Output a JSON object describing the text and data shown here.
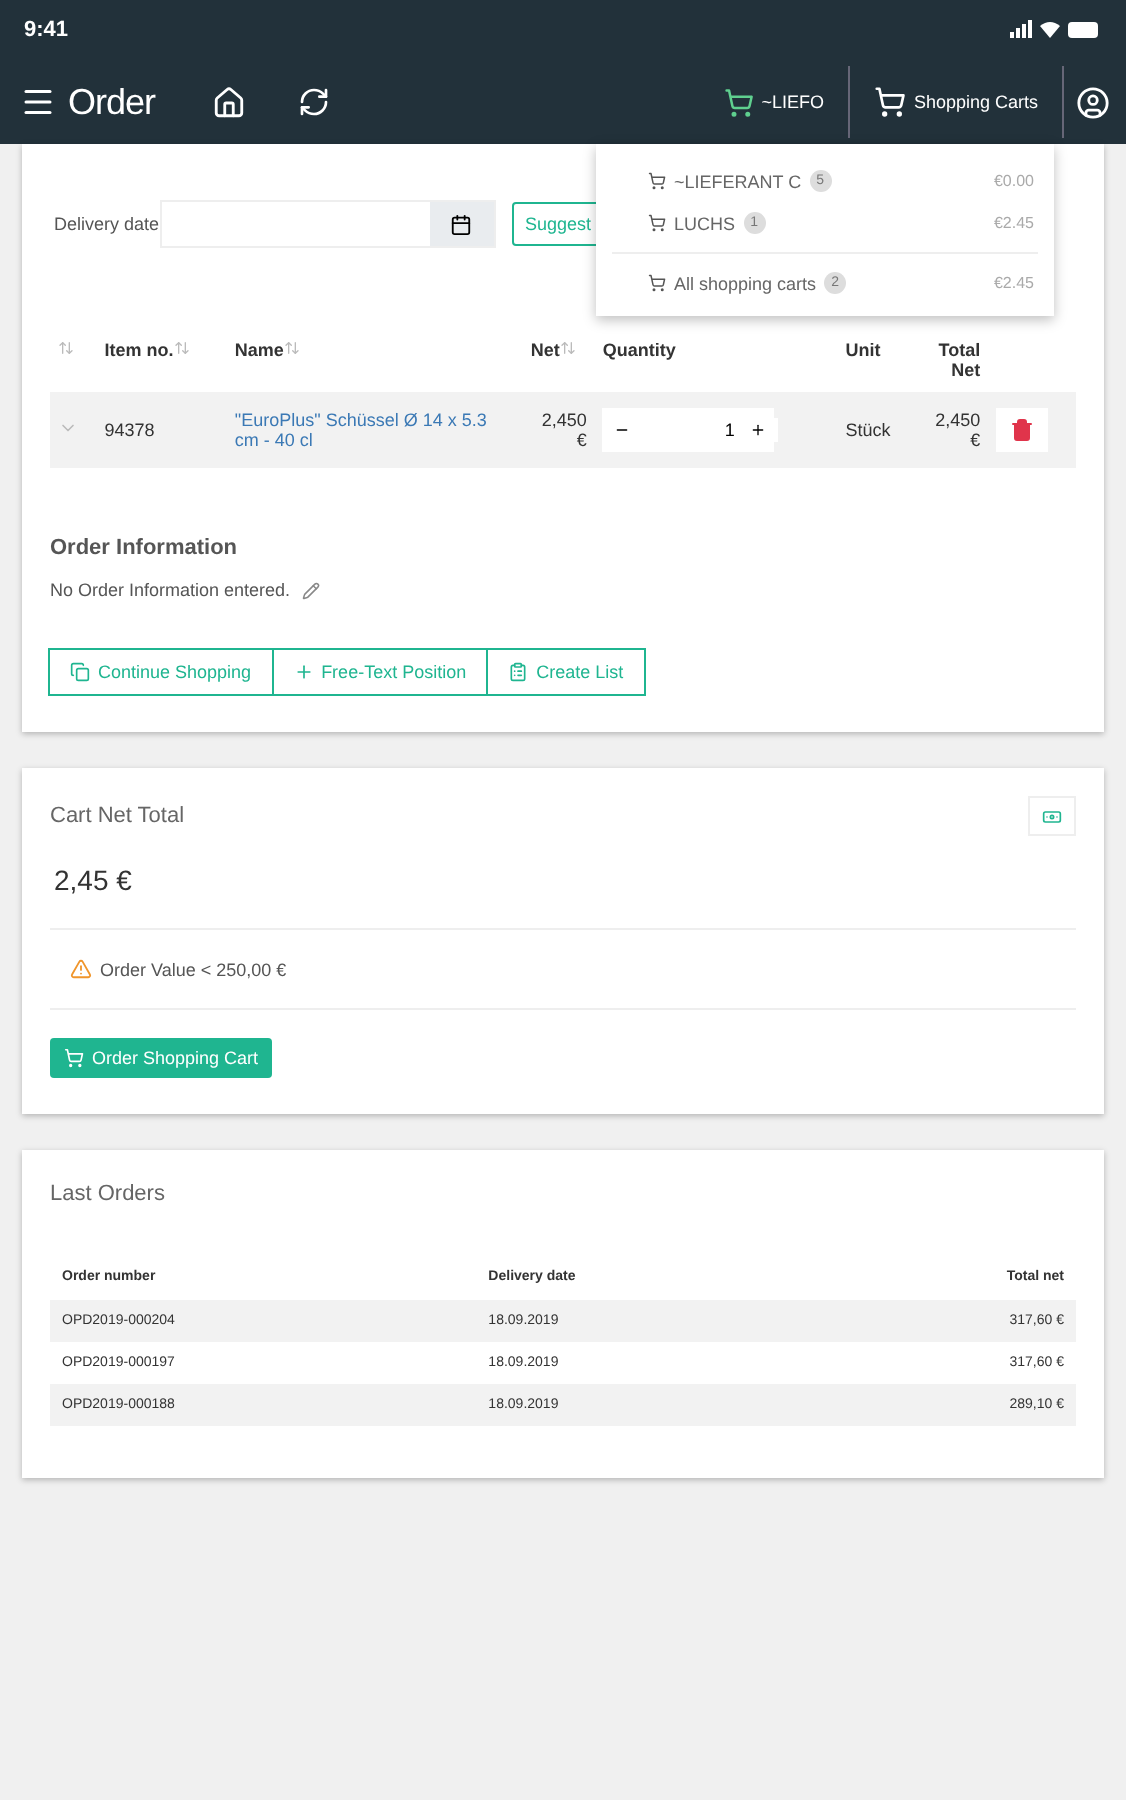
{
  "status_bar": {
    "time": "9:41"
  },
  "nav": {
    "title": "Order",
    "cart_label": "~LIEFO",
    "carts_label": "Shopping Carts"
  },
  "carts_menu": {
    "items": [
      {
        "name": "~LIEFERANT C",
        "count": "5",
        "amount": "€0.00"
      },
      {
        "name": "LUCHS",
        "count": "1",
        "amount": "€2.45"
      }
    ],
    "total": {
      "name": "All shopping carts",
      "count": "2",
      "amount": "€2.45"
    }
  },
  "order_card": {
    "delivery_label": "Delivery date",
    "suggest_button": "Suggest",
    "columns": [
      "Item no.",
      "Name",
      "Net",
      "Quantity",
      "Unit",
      "Total Net"
    ],
    "rows": [
      {
        "item_no": "94378",
        "name": "\"EuroPlus\" Schüssel Ø 14 x 5.3 cm - 40 cl",
        "net": "2,450 €",
        "quantity": "1",
        "unit": "Stück",
        "total": "2,450 €"
      }
    ],
    "info_title": "Order Information",
    "info_text": "No Order Information entered.",
    "buttons": [
      {
        "kind": "continue",
        "label": "Continue Shopping"
      },
      {
        "kind": "add",
        "label": "Free-Text Position"
      },
      {
        "kind": "list",
        "label": "Create List"
      }
    ]
  },
  "total_card": {
    "title": "Cart Net Total",
    "amount": "2,45 €",
    "warning": "Order Value < 250,00 €",
    "order_button": "Order Shopping Cart"
  },
  "last_orders": {
    "title": "Last Orders",
    "columns": [
      "Order number",
      "Delivery date",
      "Total net"
    ],
    "rows": [
      [
        "OPD2019-000204",
        "18.09.2019",
        "317,60 €"
      ],
      [
        "OPD2019-000197",
        "18.09.2019",
        "317,60 €"
      ],
      [
        "OPD2019-000188",
        "18.09.2019",
        "289,10 €"
      ]
    ]
  }
}
